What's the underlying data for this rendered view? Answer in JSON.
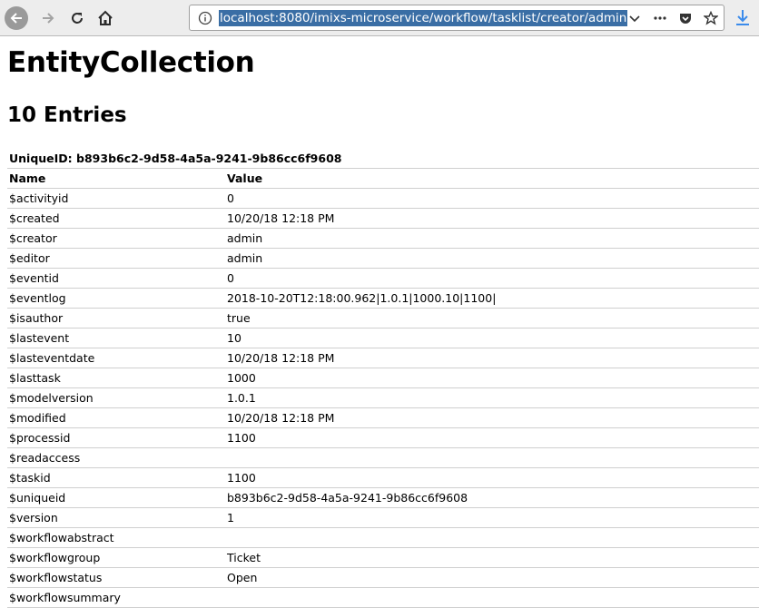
{
  "browser": {
    "url": "localhost:8080/imixs-microservice/workflow/tasklist/creator/admin"
  },
  "page": {
    "title": "EntityCollection",
    "entry_count": "10 Entries"
  },
  "table": {
    "unique_id_header": "UniqueID: b893b6c2-9d58-4a5a-9241-9b86cc6f9608",
    "columns": [
      "Name",
      "Value"
    ],
    "rows": [
      {
        "name": "$activityid",
        "value": "0"
      },
      {
        "name": "$created",
        "value": "10/20/18 12:18 PM"
      },
      {
        "name": "$creator",
        "value": "admin"
      },
      {
        "name": "$editor",
        "value": "admin"
      },
      {
        "name": "$eventid",
        "value": "0"
      },
      {
        "name": "$eventlog",
        "value": "2018-10-20T12:18:00.962|1.0.1|1000.10|1100|"
      },
      {
        "name": "$isauthor",
        "value": "true"
      },
      {
        "name": "$lastevent",
        "value": "10"
      },
      {
        "name": "$lasteventdate",
        "value": "10/20/18 12:18 PM"
      },
      {
        "name": "$lasttask",
        "value": "1000"
      },
      {
        "name": "$modelversion",
        "value": "1.0.1"
      },
      {
        "name": "$modified",
        "value": "10/20/18 12:18 PM"
      },
      {
        "name": "$processid",
        "value": "1100"
      },
      {
        "name": "$readaccess",
        "value": ""
      },
      {
        "name": "$taskid",
        "value": "1100"
      },
      {
        "name": "$uniqueid",
        "value": "b893b6c2-9d58-4a5a-9241-9b86cc6f9608"
      },
      {
        "name": "$version",
        "value": "1"
      },
      {
        "name": "$workflowabstract",
        "value": ""
      },
      {
        "name": "$workflowgroup",
        "value": "Ticket"
      },
      {
        "name": "$workflowstatus",
        "value": "Open"
      },
      {
        "name": "$workflowsummary",
        "value": ""
      }
    ]
  },
  "icons": {
    "back": "arrow-left-icon",
    "forward": "arrow-right-icon",
    "reload": "reload-icon",
    "home": "home-icon",
    "info": "info-icon",
    "dropdown": "chevron-down-icon",
    "more": "more-dots-icon",
    "pocket": "pocket-icon",
    "bookmark": "star-icon",
    "download": "download-icon"
  },
  "colors": {
    "url_selection": "#3a6ea5",
    "download_accent": "#3b8beb"
  }
}
